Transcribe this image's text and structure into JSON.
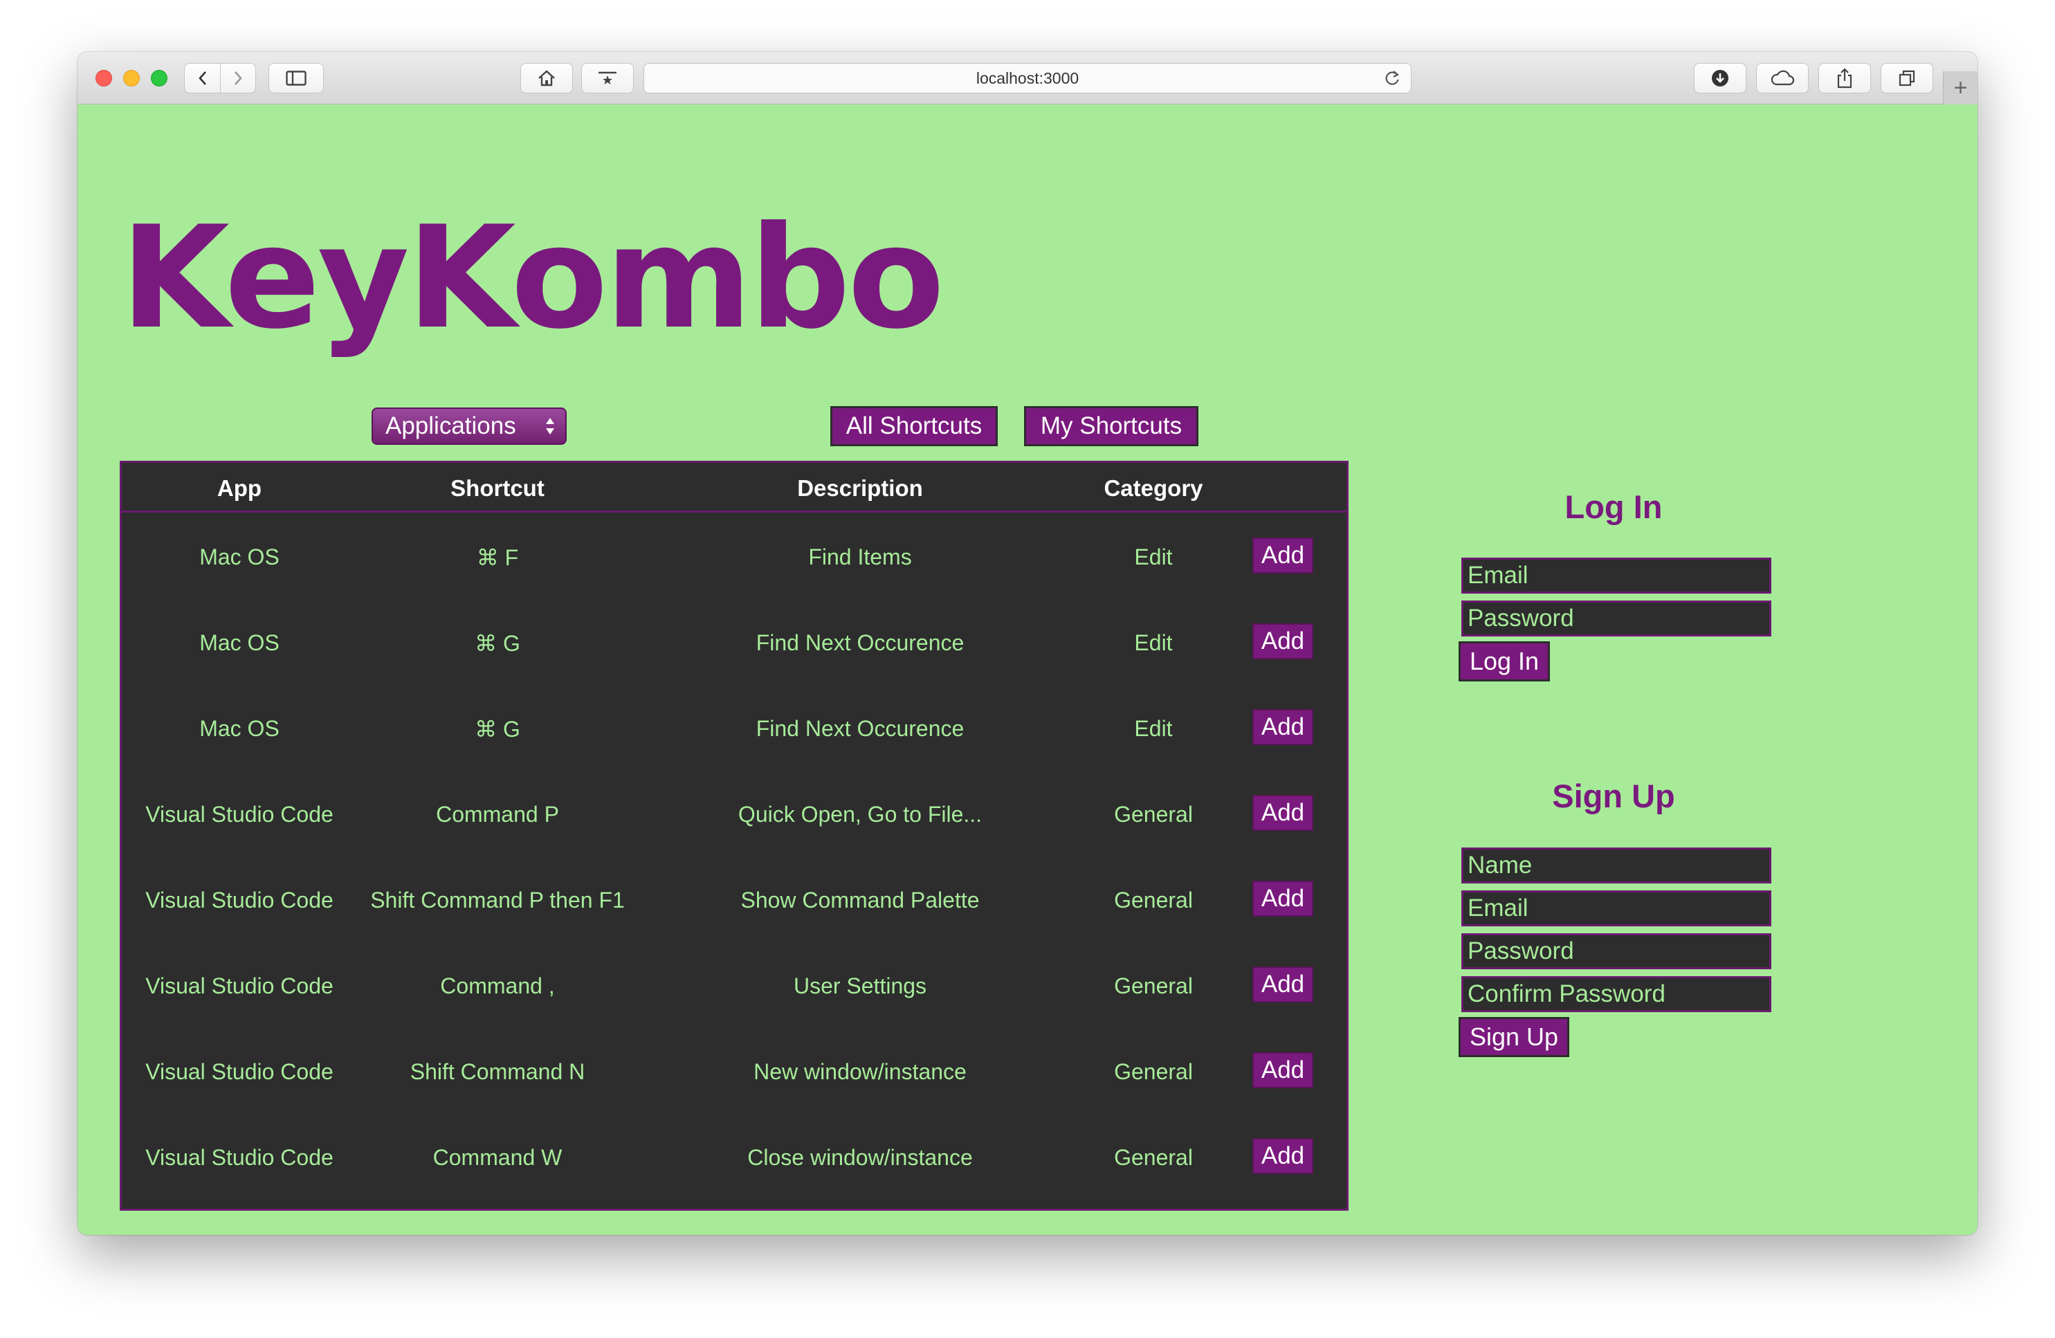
{
  "browser": {
    "url": "localhost:3000"
  },
  "app": {
    "logo": "KeyKombo",
    "app_select": "Applications",
    "nav": {
      "all_shortcuts": "All Shortcuts",
      "my_shortcuts": "My Shortcuts"
    }
  },
  "table": {
    "headers": {
      "app": "App",
      "shortcut": "Shortcut",
      "description": "Description",
      "category": "Category"
    },
    "rows": [
      {
        "app": "Mac OS",
        "shortcut": "⌘ F",
        "description": "Find Items",
        "category": "Edit",
        "action": "Add"
      },
      {
        "app": "Mac OS",
        "shortcut": "⌘ G",
        "description": "Find Next Occurence",
        "category": "Edit",
        "action": "Add"
      },
      {
        "app": "Mac OS",
        "shortcut": "⌘ G",
        "description": "Find Next Occurence",
        "category": "Edit",
        "action": "Add"
      },
      {
        "app": "Visual Studio Code",
        "shortcut": "Command P",
        "description": "Quick Open, Go to File...",
        "category": "General",
        "action": "Add"
      },
      {
        "app": "Visual Studio Code",
        "shortcut": "Shift Command P then F1",
        "description": "Show Command Palette",
        "category": "General",
        "action": "Add"
      },
      {
        "app": "Visual Studio Code",
        "shortcut": "Command ,",
        "description": "User Settings",
        "category": "General",
        "action": "Add"
      },
      {
        "app": "Visual Studio Code",
        "shortcut": "Shift Command N",
        "description": "New window/instance",
        "category": "General",
        "action": "Add"
      },
      {
        "app": "Visual Studio Code",
        "shortcut": "Command W",
        "description": "Close window/instance",
        "category": "General",
        "action": "Add"
      }
    ]
  },
  "login": {
    "title": "Log In",
    "email_placeholder": "Email",
    "password_placeholder": "Password",
    "submit": "Log In"
  },
  "signup": {
    "title": "Sign Up",
    "name_placeholder": "Name",
    "email_placeholder": "Email",
    "password_placeholder": "Password",
    "confirm_placeholder": "Confirm Password",
    "submit": "Sign Up"
  },
  "colors": {
    "background": "#a7eb99",
    "brand": "#7a1a7e",
    "panel": "#2d2d2d"
  }
}
